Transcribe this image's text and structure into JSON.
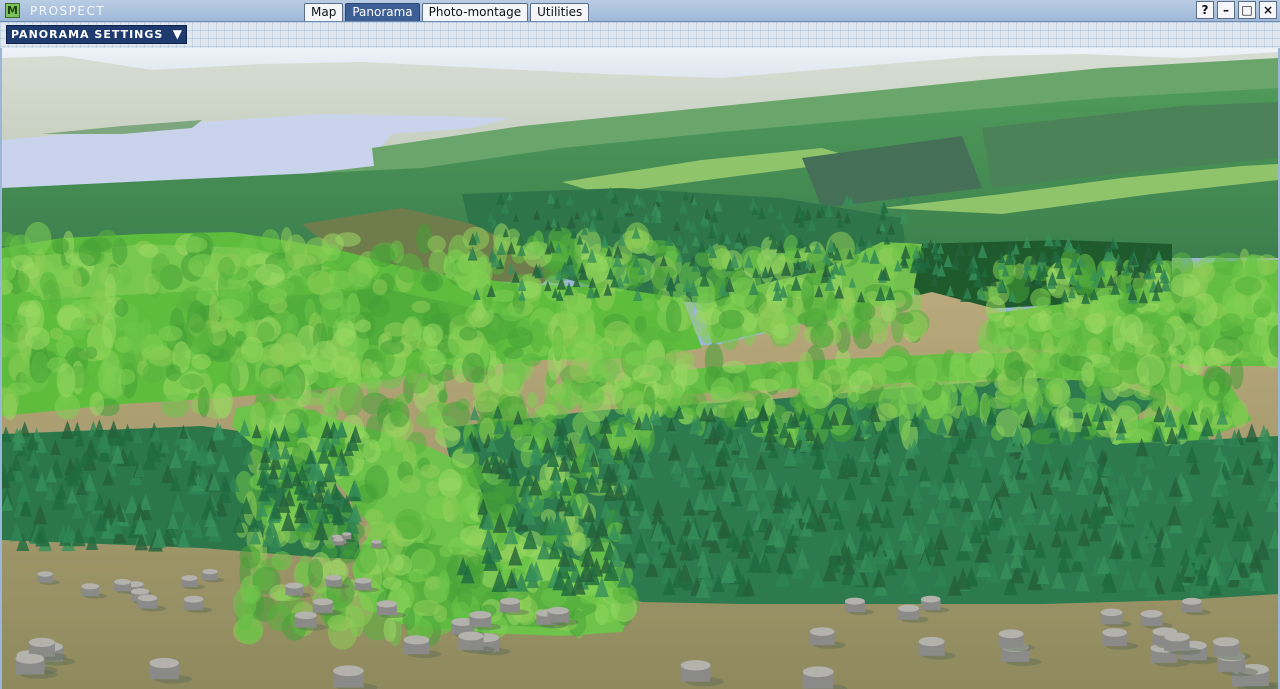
{
  "app": {
    "logo_letter": "M",
    "title": "PROSPECT"
  },
  "tabs": [
    {
      "label": "Map",
      "active": false
    },
    {
      "label": "Panorama",
      "active": true
    },
    {
      "label": "Photo-montage",
      "active": false
    },
    {
      "label": "Utilities",
      "active": false
    }
  ],
  "window_controls": {
    "help": "?",
    "minimize": "–",
    "maximize": "□",
    "close": "×"
  },
  "settings": {
    "label": "PANORAMA SETTINGS",
    "arrow": "▼"
  },
  "colors": {
    "titlebar": "#a9c2de",
    "active_tab": "#3e5f95",
    "settings_button": "#1e3a6e",
    "water": "#c9d3ec",
    "broadleaf": "#5fbd3e",
    "conifer": "#2f7a4c",
    "felled_ground": "#b8a77a"
  }
}
